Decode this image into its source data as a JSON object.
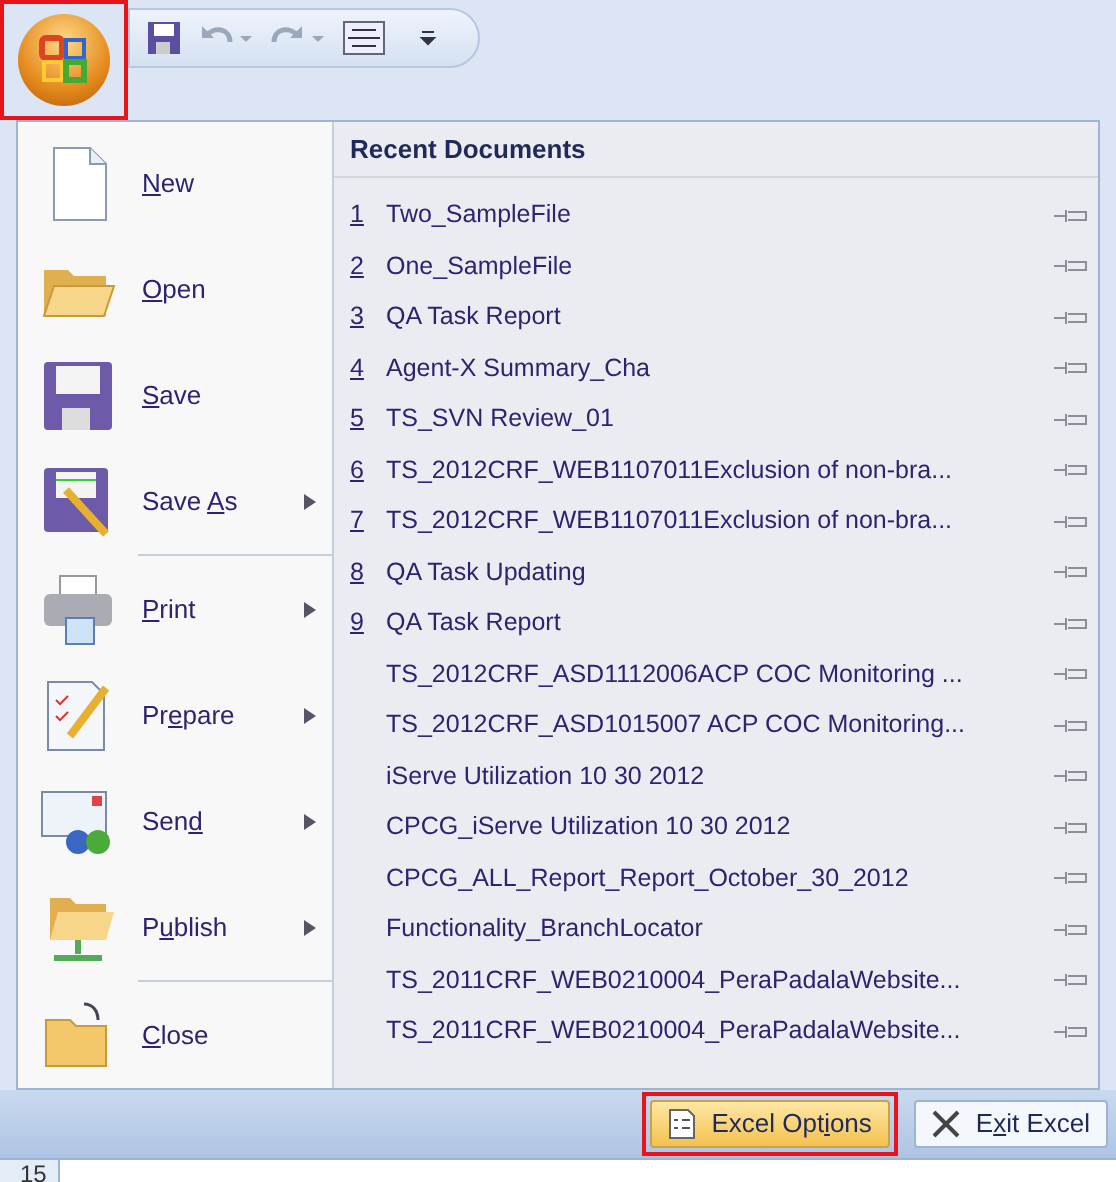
{
  "office_button": {
    "highlighted": true
  },
  "quick_access": [
    {
      "kind": "save"
    },
    {
      "kind": "undo"
    },
    {
      "kind": "redo"
    },
    {
      "kind": "wrap"
    },
    {
      "kind": "customize"
    }
  ],
  "menu_items": [
    {
      "kind": "new",
      "hotkey": "N",
      "after": "ew",
      "submenu": false,
      "separator_after": false
    },
    {
      "kind": "open",
      "hotkey": "O",
      "after": "pen",
      "submenu": false,
      "separator_after": false
    },
    {
      "kind": "save",
      "hotkey": "S",
      "after": "ave",
      "submenu": false,
      "separator_after": false
    },
    {
      "kind": "saveas",
      "before": "Save ",
      "hotkey": "A",
      "after": "s",
      "submenu": true,
      "separator_after": true
    },
    {
      "kind": "print",
      "hotkey": "P",
      "after": "rint",
      "submenu": true,
      "separator_after": false
    },
    {
      "kind": "prepare",
      "before": "Pr",
      "hotkey": "e",
      "after": "pare",
      "submenu": true,
      "separator_after": false
    },
    {
      "kind": "send",
      "before": "Sen",
      "hotkey": "d",
      "submenu": true,
      "separator_after": false
    },
    {
      "kind": "publish",
      "before": "P",
      "hotkey": "u",
      "after": "blish",
      "submenu": true,
      "separator_after": true
    },
    {
      "kind": "close",
      "hotkey": "C",
      "after": "lose",
      "submenu": false,
      "separator_after": false
    }
  ],
  "recent_documents": {
    "title": "Recent Documents",
    "items": [
      {
        "number": "1",
        "name": "Two_SampleFile"
      },
      {
        "number": "2",
        "name": "One_SampleFile"
      },
      {
        "number": "3",
        "name": "QA Task Report"
      },
      {
        "number": "4",
        "name": "Agent-X Summary_Cha"
      },
      {
        "number": "5",
        "name": "TS_SVN Review_01"
      },
      {
        "number": "6",
        "name": "TS_2012CRF_WEB1107011Exclusion of non-bra..."
      },
      {
        "number": "7",
        "name": "TS_2012CRF_WEB1107011Exclusion of non-bra..."
      },
      {
        "number": "8",
        "name": "QA Task Updating"
      },
      {
        "number": "9",
        "name": "QA Task Report"
      },
      {
        "name": "TS_2012CRF_ASD1112006ACP COC Monitoring ..."
      },
      {
        "name": "TS_2012CRF_ASD1015007 ACP COC Monitoring..."
      },
      {
        "name": "iServe Utilization 10 30 2012"
      },
      {
        "name": "CPCG_iServe Utilization 10 30 2012"
      },
      {
        "name": "CPCG_ALL_Report_Report_October_30_2012"
      },
      {
        "name": "Functionality_BranchLocator"
      },
      {
        "name": "TS_2011CRF_WEB0210004_PeraPadalaWebsite..."
      },
      {
        "name": "TS_2011CRF_WEB0210004_PeraPadalaWebsite..."
      }
    ]
  },
  "footer_buttons": [
    {
      "kind": "options",
      "before": "Excel Opt",
      "hotkey": "i",
      "after": "ons",
      "highlighted": true
    },
    {
      "kind": "exit",
      "before": "E",
      "hotkey": "x",
      "after": "it Excel",
      "highlighted": false
    }
  ],
  "row_header": "15"
}
